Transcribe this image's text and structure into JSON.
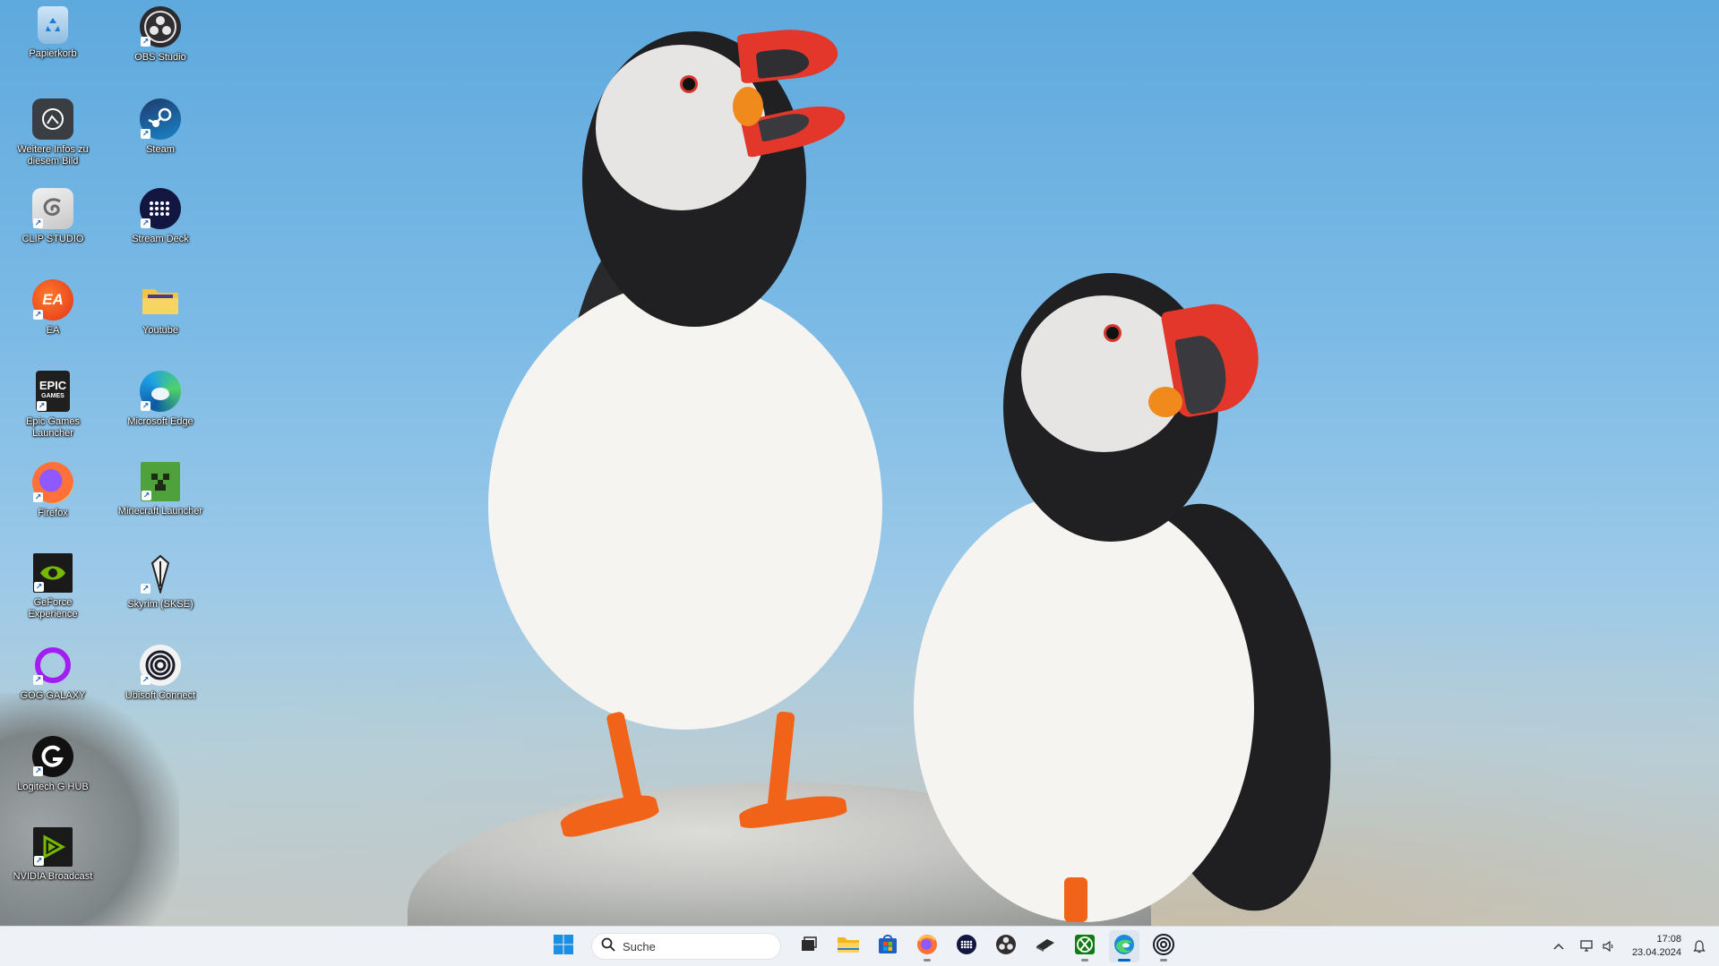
{
  "desktop_icons": [
    {
      "label": "Papierkorb",
      "icon": "recycle-bin-icon"
    },
    {
      "label": "OBS Studio",
      "icon": "obs-icon"
    },
    {
      "label": "Weitere Infos zu diesem Bild",
      "icon": "camera-info-icon"
    },
    {
      "label": "Steam",
      "icon": "steam-icon"
    },
    {
      "label": "CLIP STUDIO",
      "icon": "clip-studio-icon"
    },
    {
      "label": "Stream Deck",
      "icon": "stream-deck-icon"
    },
    {
      "label": "EA",
      "icon": "ea-icon"
    },
    {
      "label": "Youtube",
      "icon": "folder-icon"
    },
    {
      "label": "Epic Games Launcher",
      "icon": "epic-games-icon"
    },
    {
      "label": "Microsoft Edge",
      "icon": "edge-icon"
    },
    {
      "label": "Firefox",
      "icon": "firefox-icon"
    },
    {
      "label": "Minecraft Launcher",
      "icon": "minecraft-icon"
    },
    {
      "label": "GeForce Experience",
      "icon": "geforce-icon"
    },
    {
      "label": "Skyrim (SKSE)",
      "icon": "skyrim-icon"
    },
    {
      "label": "GOG GALAXY",
      "icon": "gog-galaxy-icon"
    },
    {
      "label": "Ubisoft Connect",
      "icon": "ubisoft-icon"
    },
    {
      "label": "Logitech G HUB",
      "icon": "logitech-ghub-icon"
    },
    {
      "label": "NVIDIA Broadcast",
      "icon": "nvidia-broadcast-icon"
    }
  ],
  "taskbar": {
    "search_placeholder": "Suche",
    "pinned_apps": [
      {
        "name": "start",
        "icon": "windows-start-icon"
      },
      {
        "name": "task-view",
        "icon": "task-view-icon"
      },
      {
        "name": "file-explorer",
        "icon": "folder-icon"
      },
      {
        "name": "microsoft-store",
        "icon": "store-icon"
      },
      {
        "name": "firefox",
        "icon": "firefox-icon",
        "running": true
      },
      {
        "name": "stream-deck",
        "icon": "stream-deck-icon"
      },
      {
        "name": "obs-studio",
        "icon": "obs-icon"
      },
      {
        "name": "unknown-app",
        "icon": "dark-app-icon"
      },
      {
        "name": "xbox",
        "icon": "xbox-icon",
        "running": true
      },
      {
        "name": "edge",
        "icon": "edge-icon",
        "running": true,
        "focused": true
      },
      {
        "name": "ubisoft-connect",
        "icon": "ubisoft-icon",
        "running": true
      }
    ],
    "tray": {
      "chevron_icon": "chevron-up-icon",
      "network_icon": "network-icon",
      "volume_icon": "volume-icon",
      "time": "17:08",
      "date": "23.04.2024",
      "notification_icon": "bell-icon"
    }
  },
  "colors": {
    "taskbar_bg": "#eef1f6",
    "accent": "#0067c0",
    "sky": "#7dbbe6"
  }
}
